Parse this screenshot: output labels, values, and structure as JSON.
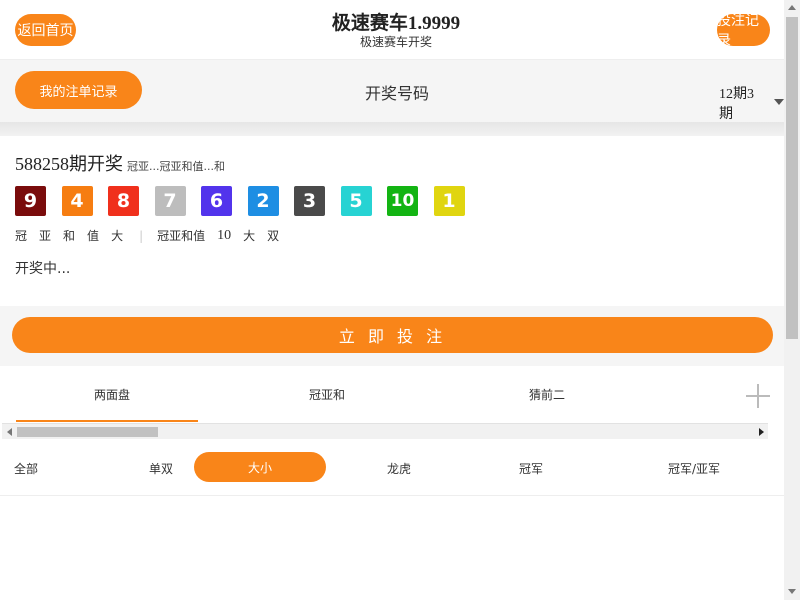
{
  "header": {
    "left_button": "返回首页",
    "title": "极速赛车1.9999",
    "subtitle": "极速赛车开奖",
    "right_button": "投注记录"
  },
  "toolbar": {
    "left_button": "我的注单记录",
    "title": "开奖号码",
    "select_value": "12期3期"
  },
  "result": {
    "issue": "588258",
    "issue_suffix": "期开奖",
    "note": "冠亚...冠亚和值...和",
    "balls": [
      {
        "num": "9",
        "color": "#7a0c0c"
      },
      {
        "num": "4",
        "color": "#f67d11"
      },
      {
        "num": "8",
        "color": "#f0301c"
      },
      {
        "num": "7",
        "color": "#bdbdbd"
      },
      {
        "num": "6",
        "color": "#5234ec"
      },
      {
        "num": "2",
        "color": "#1e8ee3"
      },
      {
        "num": "3",
        "color": "#4a4a4a"
      },
      {
        "num": "5",
        "color": "#27d3d3"
      },
      {
        "num": "10",
        "color": "#13b413"
      },
      {
        "num": "1",
        "color": "#e0d510"
      }
    ],
    "stats": {
      "items": [
        "冠",
        "亚",
        "和",
        "值",
        "大"
      ],
      "label": "冠亚和值",
      "value": "10",
      "tail": [
        "大",
        "双"
      ]
    },
    "countdown": "开奖中..."
  },
  "bet_button": "立 即 投 注",
  "tabs": [
    "两面盘",
    "冠亚和",
    "猜前二"
  ],
  "filters": [
    "全部",
    "单双",
    "大小",
    "龙虎",
    "冠军",
    "冠军/亚军"
  ],
  "filters_active_index": 2,
  "colors": {
    "accent": "#f98519",
    "background_gray": "#f5f5f5"
  }
}
